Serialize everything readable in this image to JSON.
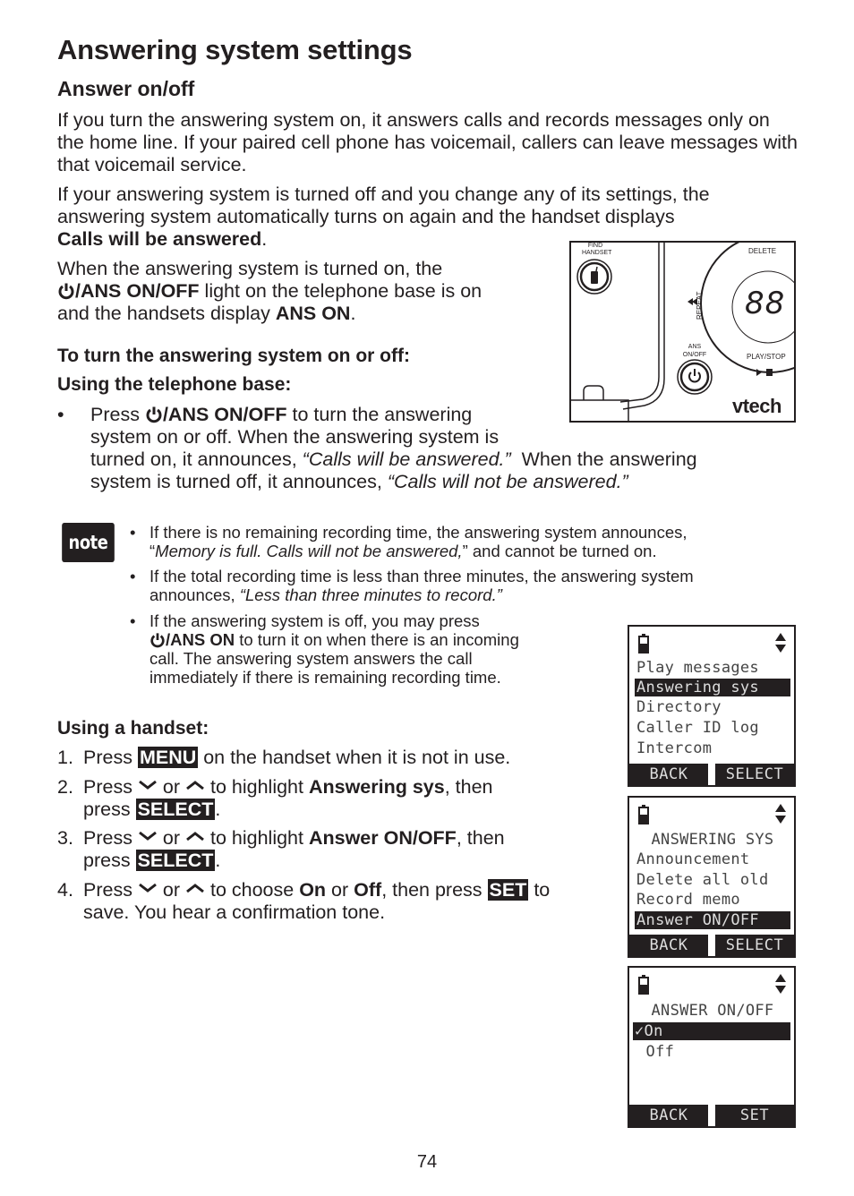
{
  "page": {
    "title": "Answering system settings",
    "section_title": "Answer on/off",
    "page_number": "74"
  },
  "intro": {
    "p1": "If you turn the answering system on, it answers calls and records messages only on the home line. If your paired cell phone has voicemail, callers can leave messages with that voicemail service.",
    "p2_line1": "If your answering system is turned off and you change any of its settings, the",
    "p2_line2": "answering system automatically turns on again and the handset displays",
    "p2_bold": "Calls will be answered",
    "p2_end": ".",
    "p3_line1": "When the answering system is turned on, the",
    "p3_key": "/ANS ON/OFF",
    "p3_mid": " light on the telephone base is on",
    "p3_line3_start": "and the handsets display ",
    "p3_bold2": "ANS ON",
    "p3_end": "."
  },
  "instructions": {
    "heading": "To turn the answering system on or off:",
    "base_heading": "Using the telephone base:",
    "base_bullet": {
      "press": "Press ",
      "key": "/ANS ON/OFF",
      "after_key": " to turn the answering",
      "line2": "system on or off. When the answering system is",
      "line3_start": "turned on, it announces, ",
      "quote_on": "“Calls will be answered.”",
      "line3_end": "  When the answering",
      "line4_start": "system is turned off, it announces, ",
      "quote_off": "“Calls will not be answered.”"
    }
  },
  "note": {
    "badge": "note",
    "items": [
      {
        "line1": "If there is no remaining recording time, the answering system announces,",
        "line2_open": "“",
        "line2_ital": "Memory is full. Calls will not be answered,",
        "line2_close": "” and cannot be turned on."
      },
      {
        "line1": "If the total recording time is less than three minutes, the answering system",
        "line2_start": "announces, ",
        "line2_ital": "“Less than three minutes to record.”"
      },
      {
        "line1": "If the answering system is off, you may press",
        "line2_key": "/ANS ON",
        "line2_rest": " to turn it on when there is an incoming",
        "line3": "call. The answering system answers the call",
        "line4": "immediately if there is remaining recording time."
      }
    ]
  },
  "handset": {
    "heading": "Using a handset:",
    "steps": [
      {
        "num": "1.",
        "a": "Press ",
        "key": "MENU",
        "b": " on the handset when it is not in use."
      },
      {
        "num": "2.",
        "a": "Press ",
        "or": " or ",
        "b": " to highlight ",
        "bold": "Answering sys",
        "c": ", then",
        "line2_a": "press ",
        "key": "SELECT",
        "line2_b": "."
      },
      {
        "num": "3.",
        "a": "Press ",
        "or": " or ",
        "b": " to highlight ",
        "bold": "Answer ON/OFF",
        "c": ", then",
        "line2_a": "press ",
        "key": "SELECT",
        "line2_b": "."
      },
      {
        "num": "4.",
        "a": "Press ",
        "or": " or ",
        "b": " to choose ",
        "bold1": "On",
        "mid": " or ",
        "bold2": "Off",
        "c": ", then press ",
        "key": "SET",
        "d": " to",
        "line2": "save. You hear a confirmation tone."
      }
    ]
  },
  "base_illustration": {
    "find_handset": [
      "FIND",
      "HANDSET"
    ],
    "delete": "DELETE",
    "repeat": "REPEAT",
    "display": "88",
    "ans_onoff": [
      "ANS",
      "ON/OFF"
    ],
    "play_stop": "PLAY/STOP",
    "brand": "vtech"
  },
  "screens": [
    {
      "lines": [
        "Play messages",
        "Answering sys",
        "Directory",
        "Caller ID log",
        "Intercom"
      ],
      "highlighted": 1,
      "soft_left": "BACK",
      "soft_right": "SELECT"
    },
    {
      "title": "ANSWERING SYS",
      "lines": [
        "Announcement",
        "Delete all old",
        "Record memo",
        "Answer ON/OFF"
      ],
      "highlighted": 3,
      "soft_left": "BACK",
      "soft_right": "SELECT"
    },
    {
      "title": "ANSWER ON/OFF",
      "lines": [
        "✓On",
        " Off"
      ],
      "highlighted": 0,
      "soft_left": "BACK",
      "soft_right": "SET"
    }
  ]
}
